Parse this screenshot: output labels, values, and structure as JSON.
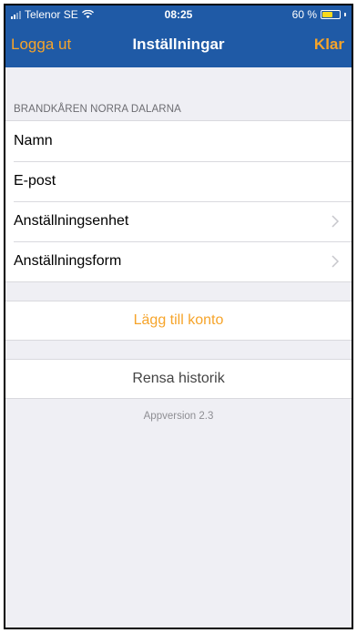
{
  "status_bar": {
    "carrier": "Telenor SE",
    "time": "08:25",
    "battery_text": "60 %",
    "battery_level": 0.6,
    "battery_color": "#f7d91c"
  },
  "nav": {
    "left_label": "Logga ut",
    "title": "Inställningar",
    "right_label": "Klar",
    "background": "#1f5aa6",
    "accent": "#f6a42a"
  },
  "account_section": {
    "header": "BRANDKÅREN NORRA DALARNA",
    "rows": [
      {
        "label": "Namn",
        "chevron": false
      },
      {
        "label": "E-post",
        "chevron": false
      },
      {
        "label": "Anställningsenhet",
        "chevron": true,
        "icon": "chevron-right-icon"
      },
      {
        "label": "Anställningsform",
        "chevron": true,
        "icon": "chevron-right-icon"
      }
    ]
  },
  "add_account_label": "Lägg till konto",
  "clear_history_label": "Rensa historik",
  "app_version": "Appversion 2.3"
}
